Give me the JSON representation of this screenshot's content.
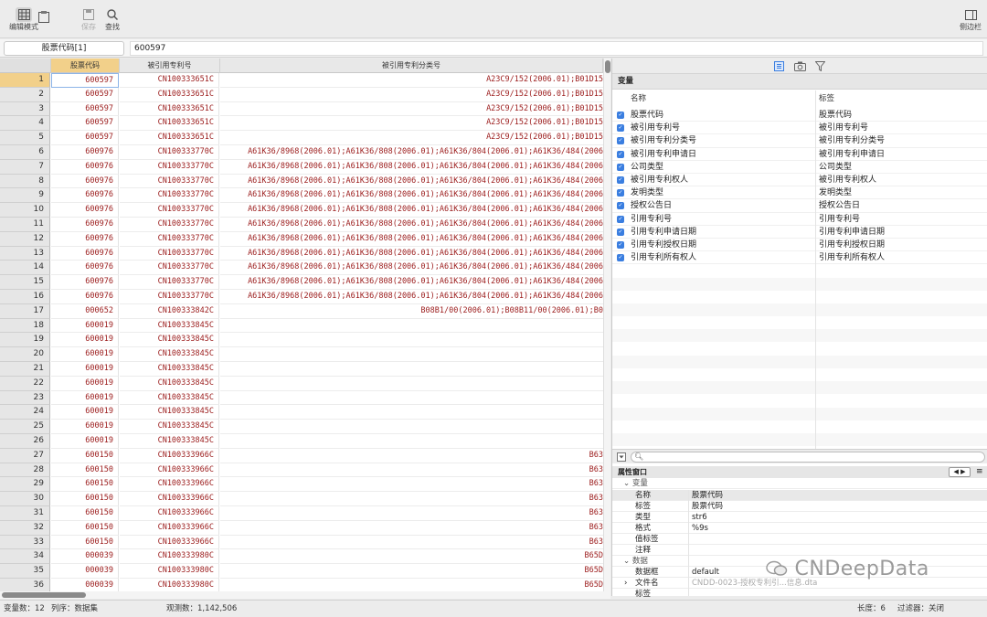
{
  "toolbar": {
    "edit_mode": "编辑模式",
    "save": "保存",
    "find": "查找",
    "sidebar": "侧边栏"
  },
  "command": {
    "varname": "股票代码[1]",
    "value": "600597"
  },
  "grid": {
    "columns": [
      "股票代码",
      "被引用专利号",
      "被引用专利分类号"
    ],
    "rows": [
      [
        "1",
        "600597",
        "CN100333651C",
        "A23C9/152(2006.01);B01D15"
      ],
      [
        "2",
        "600597",
        "CN100333651C",
        "A23C9/152(2006.01);B01D15"
      ],
      [
        "3",
        "600597",
        "CN100333651C",
        "A23C9/152(2006.01);B01D15"
      ],
      [
        "4",
        "600597",
        "CN100333651C",
        "A23C9/152(2006.01);B01D15"
      ],
      [
        "5",
        "600597",
        "CN100333651C",
        "A23C9/152(2006.01);B01D15"
      ],
      [
        "6",
        "600976",
        "CN100333770C",
        "A61K36/8968(2006.01);A61K36/808(2006.01);A61K36/804(2006.01);A61K36/484(2006"
      ],
      [
        "7",
        "600976",
        "CN100333770C",
        "A61K36/8968(2006.01);A61K36/808(2006.01);A61K36/804(2006.01);A61K36/484(2006"
      ],
      [
        "8",
        "600976",
        "CN100333770C",
        "A61K36/8968(2006.01);A61K36/808(2006.01);A61K36/804(2006.01);A61K36/484(2006"
      ],
      [
        "9",
        "600976",
        "CN100333770C",
        "A61K36/8968(2006.01);A61K36/808(2006.01);A61K36/804(2006.01);A61K36/484(2006"
      ],
      [
        "10",
        "600976",
        "CN100333770C",
        "A61K36/8968(2006.01);A61K36/808(2006.01);A61K36/804(2006.01);A61K36/484(2006"
      ],
      [
        "11",
        "600976",
        "CN100333770C",
        "A61K36/8968(2006.01);A61K36/808(2006.01);A61K36/804(2006.01);A61K36/484(2006"
      ],
      [
        "12",
        "600976",
        "CN100333770C",
        "A61K36/8968(2006.01);A61K36/808(2006.01);A61K36/804(2006.01);A61K36/484(2006"
      ],
      [
        "13",
        "600976",
        "CN100333770C",
        "A61K36/8968(2006.01);A61K36/808(2006.01);A61K36/804(2006.01);A61K36/484(2006"
      ],
      [
        "14",
        "600976",
        "CN100333770C",
        "A61K36/8968(2006.01);A61K36/808(2006.01);A61K36/804(2006.01);A61K36/484(2006"
      ],
      [
        "15",
        "600976",
        "CN100333770C",
        "A61K36/8968(2006.01);A61K36/808(2006.01);A61K36/804(2006.01);A61K36/484(2006"
      ],
      [
        "16",
        "600976",
        "CN100333770C",
        "A61K36/8968(2006.01);A61K36/808(2006.01);A61K36/804(2006.01);A61K36/484(2006"
      ],
      [
        "17",
        "000652",
        "CN100333842C",
        "B08B1/00(2006.01);B08B11/00(2006.01);B0"
      ],
      [
        "18",
        "600019",
        "CN100333845C",
        ""
      ],
      [
        "19",
        "600019",
        "CN100333845C",
        ""
      ],
      [
        "20",
        "600019",
        "CN100333845C",
        ""
      ],
      [
        "21",
        "600019",
        "CN100333845C",
        ""
      ],
      [
        "22",
        "600019",
        "CN100333845C",
        ""
      ],
      [
        "23",
        "600019",
        "CN100333845C",
        ""
      ],
      [
        "24",
        "600019",
        "CN100333845C",
        ""
      ],
      [
        "25",
        "600019",
        "CN100333845C",
        ""
      ],
      [
        "26",
        "600019",
        "CN100333845C",
        ""
      ],
      [
        "27",
        "600150",
        "CN100333966C",
        "B63"
      ],
      [
        "28",
        "600150",
        "CN100333966C",
        "B63"
      ],
      [
        "29",
        "600150",
        "CN100333966C",
        "B63"
      ],
      [
        "30",
        "600150",
        "CN100333966C",
        "B63"
      ],
      [
        "31",
        "600150",
        "CN100333966C",
        "B63"
      ],
      [
        "32",
        "600150",
        "CN100333966C",
        "B63"
      ],
      [
        "33",
        "600150",
        "CN100333966C",
        "B63"
      ],
      [
        "34",
        "000039",
        "CN100333980C",
        "B65D"
      ],
      [
        "35",
        "000039",
        "CN100333980C",
        "B65D"
      ],
      [
        "36",
        "000039",
        "CN100333980C",
        "B65D"
      ]
    ]
  },
  "variables": {
    "title": "变量",
    "col_name": "名称",
    "col_label": "标签",
    "items": [
      [
        "股票代码",
        "股票代码"
      ],
      [
        "被引用专利号",
        "被引用专利号"
      ],
      [
        "被引用专利分类号",
        "被引用专利分类号"
      ],
      [
        "被引用专利申请日",
        "被引用专利申请日"
      ],
      [
        "公司类型",
        "公司类型"
      ],
      [
        "被引用专利权人",
        "被引用专利权人"
      ],
      [
        "发明类型",
        "发明类型"
      ],
      [
        "授权公告日",
        "授权公告日"
      ],
      [
        "引用专利号",
        "引用专利号"
      ],
      [
        "引用专利申请日期",
        "引用专利申请日期"
      ],
      [
        "引用专利授权日期",
        "引用专利授权日期"
      ],
      [
        "引用专利所有权人",
        "引用专利所有权人"
      ]
    ]
  },
  "properties": {
    "title": "属性窗口",
    "group_var": "变量",
    "group_data": "数据",
    "rows": [
      [
        "名称",
        "股票代码"
      ],
      [
        "标签",
        "股票代码"
      ],
      [
        "类型",
        "str6"
      ],
      [
        "格式",
        "%9s"
      ],
      [
        "值标签",
        ""
      ],
      [
        "注释",
        ""
      ]
    ],
    "data_rows": [
      [
        "数据框",
        "default"
      ],
      [
        "文件名",
        "CNDD-0023-授权专利引...信息.dta"
      ],
      [
        "标签",
        ""
      ]
    ]
  },
  "status": {
    "vars": "变量数：12",
    "order": "列序：数据集",
    "obs": "观测数：1,142,506",
    "length": "长度：6",
    "filter": "过滤器：关闭"
  },
  "watermark": "CNDeepData",
  "colors": {
    "data_text": "#9b1b1b",
    "selected_row": "#f2d08a",
    "checkbox": "#3a7ee0"
  }
}
